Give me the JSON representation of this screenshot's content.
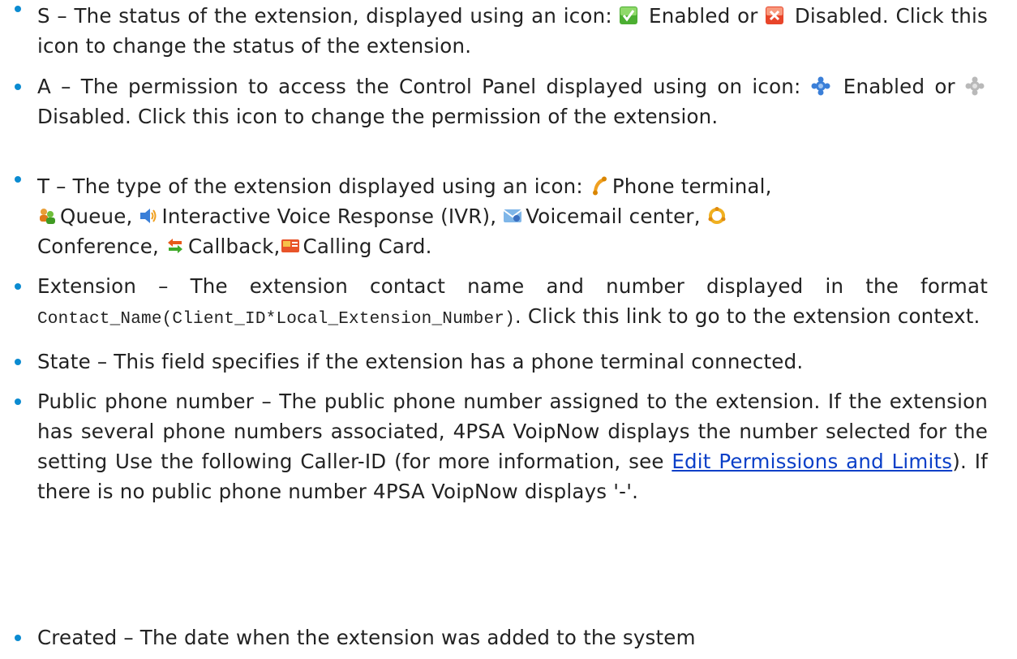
{
  "items": [
    {
      "t1": "S – The status of the extension, displayed using an icon: ",
      "icon1": "checkbox-enabled-icon",
      "t2": " Enabled or ",
      "icon2": "close-disabled-icon",
      "t3": " Disabled. Click this icon to change the status of the extension."
    },
    {
      "t1": "A – The permission to access the Control Panel displayed using on icon: ",
      "icon1": "puzzle-enabled-icon",
      "t2": " Enabled or ",
      "icon2": "puzzle-disabled-icon",
      "t3": " Disabled. Click this icon to change the permission of the extension."
    },
    {
      "t1": "T – The type of the extension displayed using an icon: ",
      "types": [
        {
          "icon": "phone-handset-icon",
          "label": "Phone terminal,"
        },
        {
          "icon": "queue-people-icon",
          "label": "Queue,"
        },
        {
          "icon": "ivr-speaker-icon",
          "label": "Interactive Voice Response (IVR),"
        },
        {
          "icon": "voicemail-envelope-icon",
          "label": "Voicemail center,"
        },
        {
          "icon": "conference-ring-icon",
          "label": "Conference,"
        },
        {
          "icon": "callback-arrows-icon",
          "label": "Callback,"
        },
        {
          "icon": "calling-card-icon",
          "label": "Calling Card."
        }
      ]
    },
    {
      "t1": "Extension – The extension contact name and number displayed in the format ",
      "code": "Contact_Name(Client_ID*Local_Extension_Number)",
      "t2": ". Click this link to go to the extension context."
    },
    {
      "t1": "State – This field specifies if the extension has a phone terminal connected."
    },
    {
      "t1": "Public phone number – The public phone number assigned to the extension. If the extension has several phone numbers associated, 4PSA VoipNow displays the number selected for the setting Use the following Caller-ID (for more information, see ",
      "link": "Edit Permissions and Limits",
      "t2": "). If there is no public phone number 4PSA VoipNow displays '-'."
    },
    {
      "t1": "Created – The date when the extension was added to the system"
    }
  ],
  "colors": {
    "bullet": "#0b8bd1",
    "link": "#0a3fc8",
    "text": "#222222"
  }
}
